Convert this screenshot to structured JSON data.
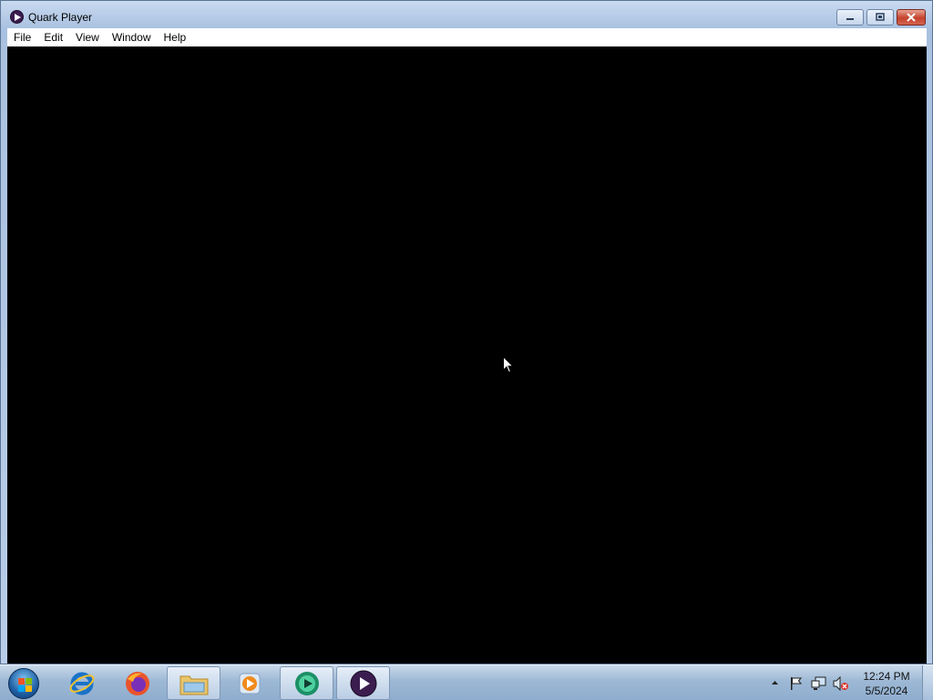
{
  "window": {
    "title": "Quark Player",
    "app_icon": "play-icon"
  },
  "menu": {
    "items": [
      "File",
      "Edit",
      "View",
      "Window",
      "Help"
    ]
  },
  "taskbar": {
    "pinned": [
      {
        "name": "internet-explorer-icon"
      },
      {
        "name": "firefox-icon"
      },
      {
        "name": "file-explorer-icon"
      },
      {
        "name": "media-player-icon"
      },
      {
        "name": "media-center-icon"
      },
      {
        "name": "quark-player-icon"
      }
    ],
    "clock": {
      "time": "12:24 PM",
      "date": "5/5/2024"
    },
    "tray_icons": [
      "show-hidden-icons-arrow",
      "action-center-flag-icon",
      "network-icon",
      "volume-muted-icon"
    ]
  },
  "colors": {
    "video_background": "#000000",
    "app_accent": "#3b1d4f"
  }
}
